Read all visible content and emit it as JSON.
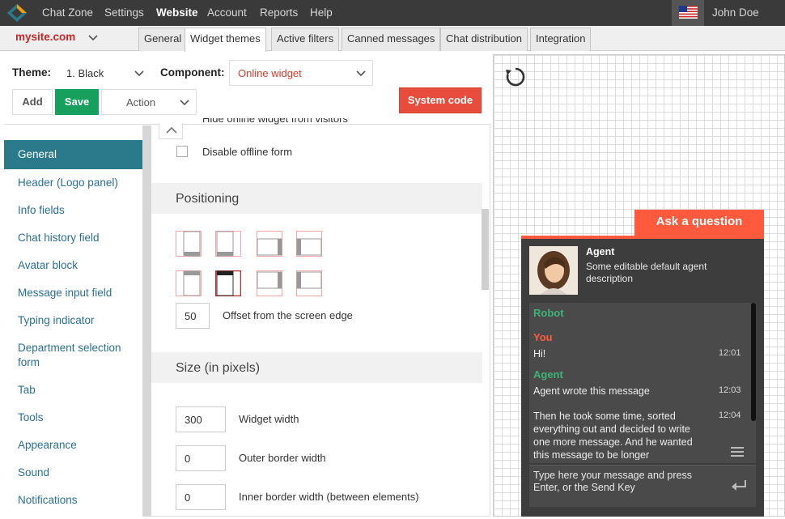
{
  "topnav": {
    "items": [
      "Chat Zone",
      "Settings",
      "Website",
      "Account",
      "Reports",
      "Help"
    ],
    "active": "Website",
    "user": "John Doe",
    "icons": {
      "logo": "logo-icon",
      "flag": "us-flag-icon"
    }
  },
  "site": {
    "name": "mysite.com"
  },
  "tabs": [
    "General",
    "Widget themes",
    "Active filters",
    "Canned messages",
    "Chat distribution",
    "Integration"
  ],
  "toolbar": {
    "theme_label": "Theme:",
    "theme_value": "1. Black",
    "component_label": "Component:",
    "component_value": "Online widget",
    "add": "Add",
    "save": "Save",
    "action": "Action",
    "system_code": "System code"
  },
  "sidebar": {
    "items": [
      "General",
      "Header (Logo panel)",
      "Info fields",
      "Chat history field",
      "Avatar block",
      "Message input field",
      "Typing indicator",
      "Department selection form",
      "Tab",
      "Tools",
      "Appearance",
      "Sound",
      "Notifications"
    ],
    "active": "General"
  },
  "settings": {
    "hide_online": "Hide online widget from visitors",
    "disable_offline": "Disable offline form",
    "positioning_title": "Positioning",
    "offset_value": "50",
    "offset_label": "Offset from the screen edge",
    "size_title": "Size (in pixels)",
    "widget_width_value": "300",
    "widget_width_label": "Widget width",
    "outer_border_value": "0",
    "outer_border_label": "Outer border width",
    "inner_border_value": "0",
    "inner_border_label": "Inner border width (between elements)"
  },
  "preview": {
    "tab_label": "Ask a question",
    "agent_name": "Agent",
    "agent_desc": "Some editable default agent description",
    "messages": [
      {
        "who": "Robot",
        "text": "",
        "time": ""
      },
      {
        "who": "You",
        "text": "Hi!",
        "time": "12:01"
      },
      {
        "who": "Agent",
        "text": "Agent wrote this message",
        "time": "12:03"
      },
      {
        "who": "",
        "text": "Then he took some time, sorted everything out and decided to write one more message. And he wanted this message to be longer",
        "time": "12:04"
      }
    ],
    "input_placeholder": "Type here your message and press Enter, or the Send Key",
    "colors": {
      "accent": "#ff5a3d",
      "robot": "#3db37a",
      "you": "#ff5a3d",
      "agent": "#3db37a"
    }
  }
}
